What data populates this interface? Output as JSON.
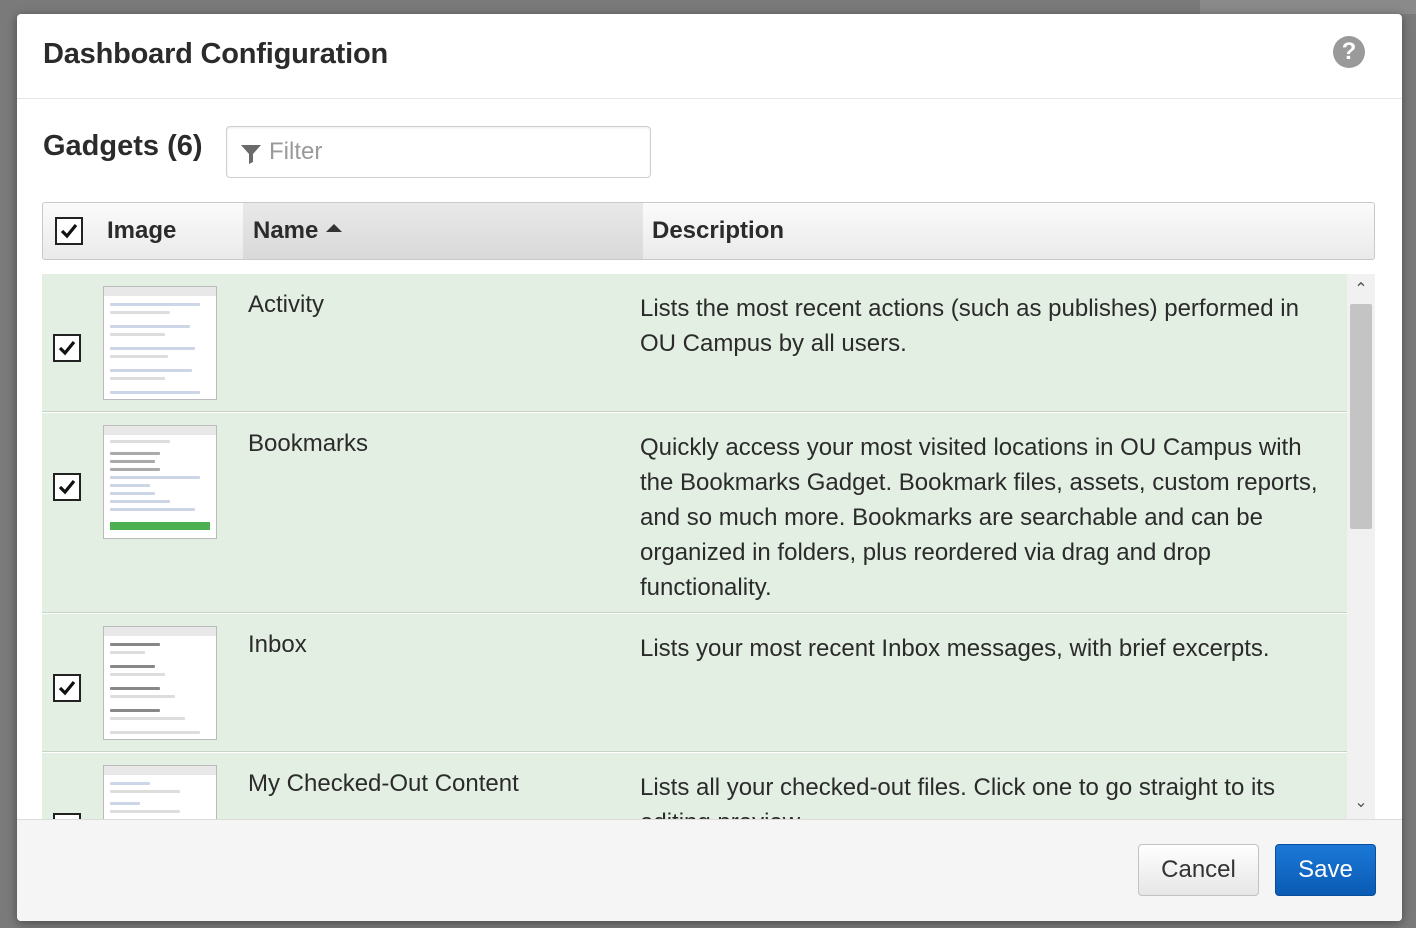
{
  "modal": {
    "title": "Dashboard Configuration",
    "help_icon": "question-circle-icon"
  },
  "gadgets": {
    "title": "Gadgets (6)",
    "filter_placeholder": "Filter",
    "filter_icon": "funnel-icon"
  },
  "table": {
    "headers": {
      "image": "Image",
      "name": "Name",
      "description": "Description"
    },
    "select_all_checked": true,
    "sort": "name-ascending",
    "rows": [
      {
        "checked": true,
        "name": "Activity",
        "description": "Lists the most recent actions (such as publishes) performed in OU Campus by all users."
      },
      {
        "checked": true,
        "name": "Bookmarks",
        "description": "Quickly access your most visited locations in OU Campus with the Bookmarks Gadget. Bookmark files, assets, custom reports, and so much more. Bookmarks are searchable and can be organized in folders, plus reordered via drag and drop functionality."
      },
      {
        "checked": true,
        "name": "Inbox",
        "description": "Lists your most recent Inbox messages, with brief excerpts."
      },
      {
        "checked": true,
        "name": "My Checked-Out Content",
        "description": "Lists all your checked-out files. Click one to go straight to its editing preview."
      }
    ]
  },
  "footer": {
    "cancel_label": "Cancel",
    "save_label": "Save"
  },
  "colors": {
    "row_bg": "#e3efe3",
    "save_button": "#0a66c6",
    "header_bg": "#eaeaea"
  }
}
